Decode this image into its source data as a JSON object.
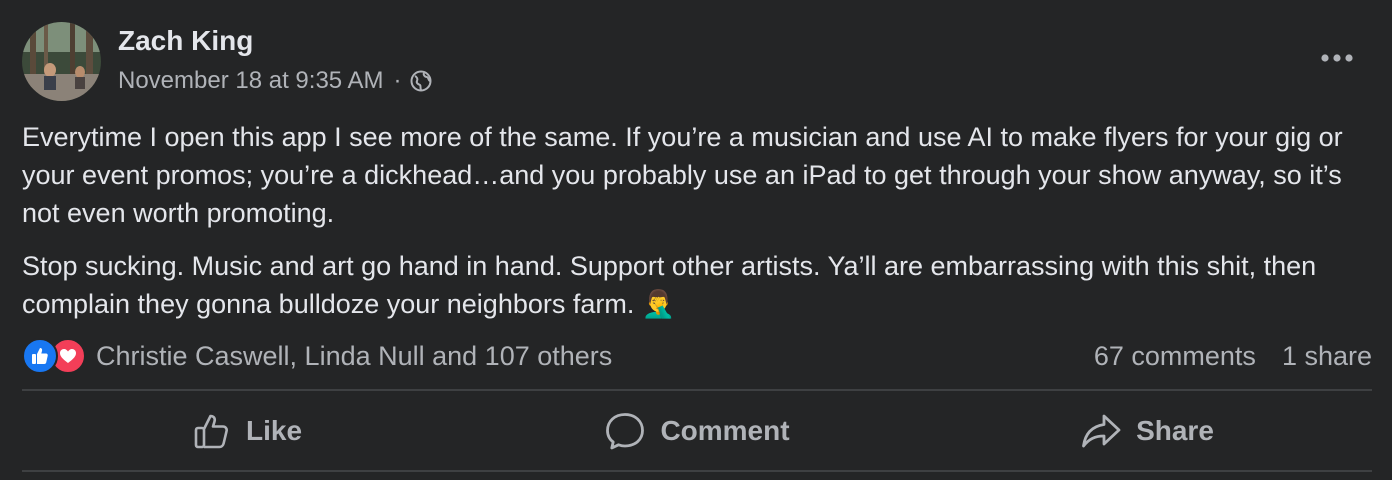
{
  "post": {
    "author": "Zach King",
    "timestamp": "November 18 at 9:35 AM",
    "separator": "·",
    "privacy_icon": "globe-icon",
    "menu_icon": "more-horizontal-icon",
    "paragraphs": [
      "Everytime I open this app I see more of the same. If you’re a musician and use AI to make flyers for your gig or your event promos; you’re a dickhead…and you probably use an iPad to get through your show anyway, so it’s not even worth promoting.",
      "Stop sucking. Music and art go hand in hand. Support other artists. Ya’ll are embarrassing with this shit, then complain they gonna bulldoze your neighbors farm. 🤦‍♂️"
    ]
  },
  "reactions": {
    "icons": [
      "like-reaction-icon",
      "love-reaction-icon"
    ],
    "names": "Christie Caswell, Linda Null and 107 others",
    "comments": "67 comments",
    "shares": "1 share"
  },
  "actions": {
    "like": "Like",
    "comment": "Comment",
    "share": "Share"
  },
  "colors": {
    "background": "#242526",
    "primary_text": "#e4e6eb",
    "secondary_text": "#b0b3b8",
    "like_blue": "#1877f2",
    "love_red": "#f33e58",
    "divider": "#3e4042"
  }
}
